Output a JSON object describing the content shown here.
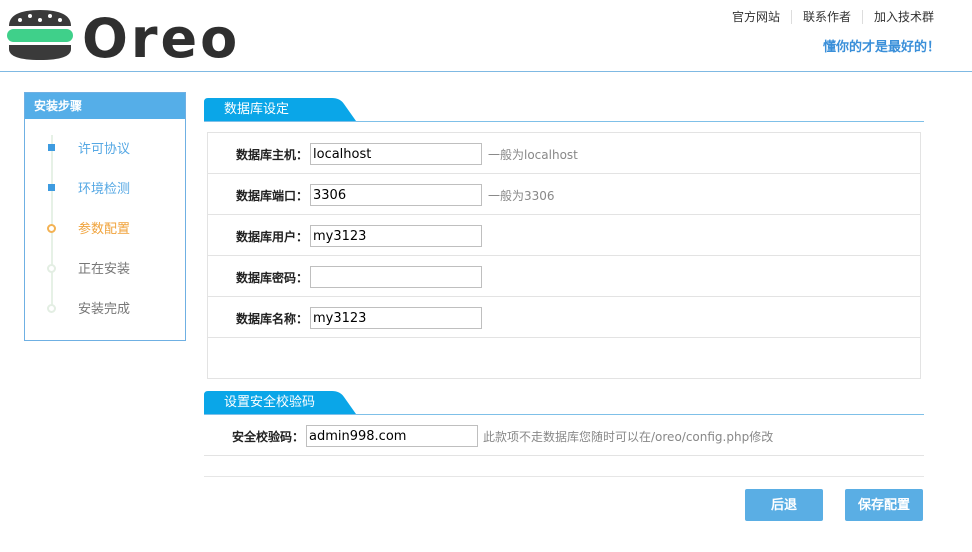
{
  "logo": {
    "text": "Oreo"
  },
  "header": {
    "links": [
      "官方网站",
      "联系作者",
      "加入技术群"
    ],
    "slogan": "懂你的才是最好的！"
  },
  "sidebar": {
    "title": "安装步骤",
    "steps": [
      {
        "label": "许可协议",
        "state": "done"
      },
      {
        "label": "环境检测",
        "state": "done"
      },
      {
        "label": "参数配置",
        "state": "current"
      },
      {
        "label": "正在安装",
        "state": "todo"
      },
      {
        "label": "安装完成",
        "state": "todo"
      }
    ]
  },
  "db_section": {
    "title": "数据库设定",
    "fields": [
      {
        "label": "数据库主机：",
        "value": "localhost",
        "hint": "一般为localhost"
      },
      {
        "label": "数据库端口：",
        "value": "3306",
        "hint": "一般为3306"
      },
      {
        "label": "数据库用户：",
        "value": "my3123",
        "hint": ""
      },
      {
        "label": "数据库密码：",
        "value": "",
        "hint": ""
      },
      {
        "label": "数据库名称：",
        "value": "my3123",
        "hint": ""
      }
    ]
  },
  "security_section": {
    "title": "设置安全校验码",
    "label": "安全校验码：",
    "value": "admin998.com",
    "hint": "此款项不走数据库您随时可以在/oreo/config.php修改"
  },
  "buttons": {
    "back": "后退",
    "save": "保存配置"
  },
  "colors": {
    "accent": "#55aee8",
    "tab": "#0aa6e8",
    "current_step": "#f0a33c",
    "slogan": "#3a8fd9",
    "logo_text": "#2f2f2f",
    "logo_green": "#3fd08a",
    "logo_dark": "#3a3a3a"
  }
}
